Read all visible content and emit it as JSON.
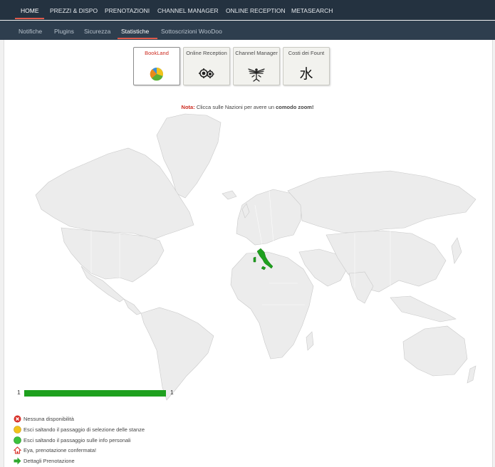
{
  "topnav": {
    "items": [
      {
        "label": "HOME",
        "active": true
      },
      {
        "label": "PREZZI & DISPO"
      },
      {
        "label": "PRENOTAZIONI"
      },
      {
        "label": "CHANNEL MANAGER"
      },
      {
        "label": "ONLINE RECEPTION"
      },
      {
        "label": "METASEARCH"
      }
    ]
  },
  "subnav": {
    "items": [
      {
        "label": "Notifiche"
      },
      {
        "label": "Plugins"
      },
      {
        "label": "Sicurezza"
      },
      {
        "label": "Statistiche",
        "active": true
      },
      {
        "label": "Sottoscrizioni WooDoo"
      }
    ]
  },
  "cards": [
    {
      "label": "BookLand",
      "icon": "pie-chart-icon",
      "active": true
    },
    {
      "label": "Online Reception",
      "icon": "gears-icon"
    },
    {
      "label": "Channel Manager",
      "icon": "eagle-icon"
    },
    {
      "label": "Costi dei Fount",
      "icon": "water-character-icon",
      "glyph": "水"
    }
  ],
  "note": {
    "label": "Nota:",
    "text": "Clicca sulle Nazioni per avere un",
    "strong": "comodo zoom!"
  },
  "map": {
    "highlighted_country": "Italy",
    "highlight_color": "#1ea01e",
    "land_color": "#ececec"
  },
  "scale": {
    "min": "1",
    "max": "1"
  },
  "legend": [
    {
      "icon": "red-x-icon",
      "text": "Nessuna disponibilità"
    },
    {
      "icon": "yellow-circle-icon",
      "text": "Esci saltando il passaggio di selezione delle stanze"
    },
    {
      "icon": "green-circle-icon",
      "text": "Esci saltando il passaggio sulle info personali"
    },
    {
      "icon": "house-icon",
      "text": "Eya, prenotazione confermata!"
    },
    {
      "icon": "green-arrow-icon",
      "text": "Dettagli Prenotazione"
    }
  ],
  "colors": {
    "topnav_bg": "#243240",
    "subnav_bg": "#2e3e4e",
    "accent": "#e05a4b",
    "highlight": "#1ea01e"
  }
}
